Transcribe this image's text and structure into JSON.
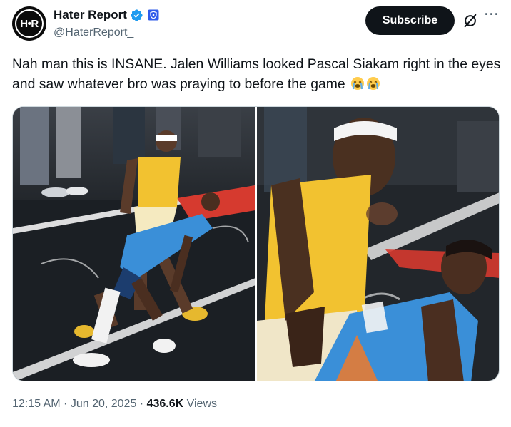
{
  "account": {
    "avatar_text": "H•R",
    "display_name": "Hater Report",
    "handle": "@HaterReport_"
  },
  "actions": {
    "subscribe_label": "Subscribe",
    "more_label": "···"
  },
  "tweet": {
    "text": "Nah man this is INSANE. Jalen Williams looked Pascal Siakam right in the eyes and saw whatever bro was praying to before the game",
    "emojis": [
      "loudly-crying-face",
      "loudly-crying-face"
    ]
  },
  "media": {
    "photos": [
      {
        "subject": "basketball-game-wide-shot"
      },
      {
        "subject": "basketball-game-closeup"
      }
    ],
    "colors": {
      "pacers_gold": "#f2c230",
      "thunder_blue": "#3a8fd8",
      "court_dark": "#1b1f24",
      "court_red": "#d63a2f"
    }
  },
  "meta": {
    "time": "12:15 AM",
    "sep1": " · ",
    "date": "Jun 20, 2025",
    "sep2": " · ",
    "views_count": "436.6K",
    "views_label": " Views"
  },
  "colors": {
    "verified_blue": "#1d9bf0",
    "affiliate_blue": "#2f5bea",
    "text_primary": "#0f1419",
    "text_secondary": "#536471"
  }
}
